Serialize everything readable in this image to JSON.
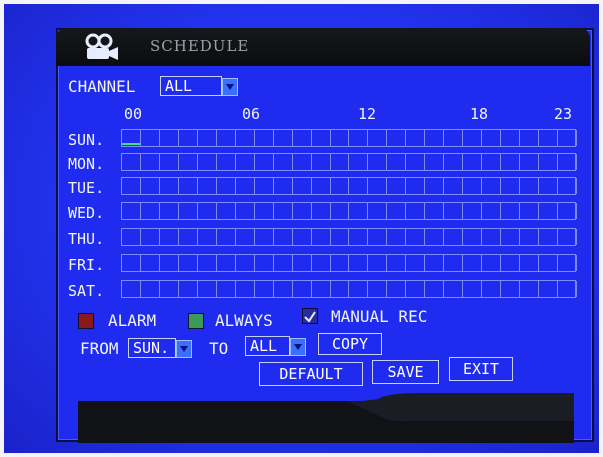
{
  "window": {
    "title": "SCHEDULE",
    "title_icon": "camera-icon"
  },
  "channel": {
    "label": "CHANNEL",
    "value": "ALL"
  },
  "hours": [
    "00",
    "06",
    "12",
    "18",
    "23"
  ],
  "days": [
    "SUN.",
    "MON.",
    "TUE.",
    "WED.",
    "THU.",
    "FRI.",
    "SAT."
  ],
  "schedule": {
    "marked_slots": [
      {
        "day": "SUN.",
        "hour": 0,
        "mode": "ALWAYS"
      }
    ]
  },
  "legend": [
    {
      "label": "ALARM",
      "color": "#8a1a1a"
    },
    {
      "label": "ALWAYS",
      "color": "#3a9a5a"
    },
    {
      "label": "MANUAL REC",
      "color": "#2a2aa0",
      "checked": true
    }
  ],
  "copy_row": {
    "from_label": "FROM",
    "from_value": "SUN.",
    "to_label": "TO",
    "to_value": "ALL",
    "copy_button": "COPY"
  },
  "buttons": {
    "default": "DEFAULT",
    "save": "SAVE",
    "exit": "EXIT"
  },
  "colors": {
    "background": "#2030e0",
    "grid": "#7e8aff",
    "selection": "#3fe08a"
  }
}
